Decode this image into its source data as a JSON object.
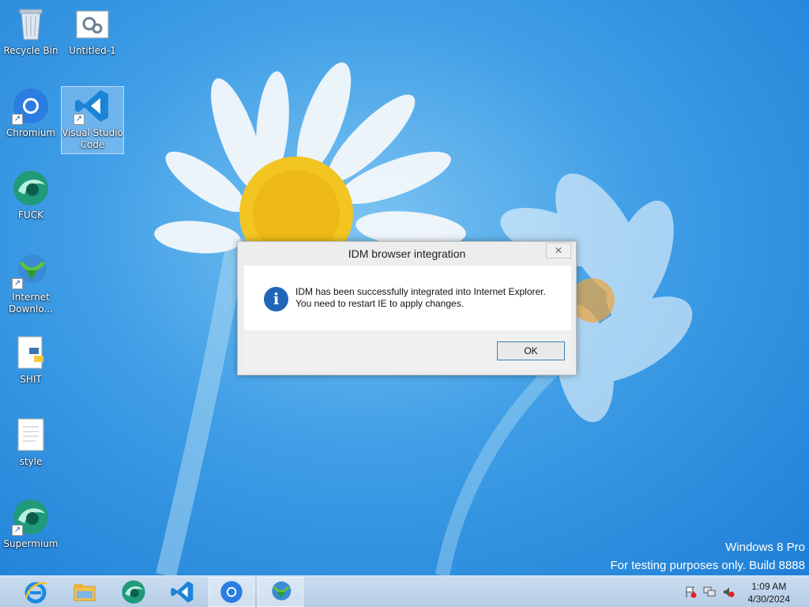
{
  "desktop_icons": [
    {
      "label": "Recycle Bin",
      "icon": "recycle-bin-icon"
    },
    {
      "label": "Untitled-1",
      "icon": "document-gear-icon"
    },
    {
      "label": "Chromium",
      "icon": "chromium-icon"
    },
    {
      "label": "Visual Studio Code",
      "icon": "vscode-icon"
    },
    {
      "label": "FUCK",
      "icon": "supermium-icon"
    },
    {
      "label": "Internet Downlo...",
      "icon": "idm-icon"
    },
    {
      "label": "SHIT",
      "icon": "python-file-icon"
    },
    {
      "label": "style",
      "icon": "text-file-icon"
    },
    {
      "label": "Supermium",
      "icon": "supermium-icon"
    }
  ],
  "watermark": {
    "edition": "Windows 8 Pro",
    "build": "For testing purposes only. Build 8888"
  },
  "dialog": {
    "title": "IDM browser integration",
    "close_label": "✕",
    "message_line1": "IDM has been successfully integrated into Internet Explorer.",
    "message_line2": "You need to restart IE to apply changes.",
    "ok_label": "OK",
    "icon": "info-icon"
  },
  "taskbar": {
    "apps": [
      "internet-explorer-icon",
      "file-explorer-icon",
      "supermium-icon",
      "vscode-icon",
      "chromium-icon",
      "idm-icon"
    ],
    "active_app": "chromium-icon"
  },
  "tray": {
    "icons": [
      "action-center-flag-icon",
      "network-icon",
      "volume-muted-icon"
    ],
    "time": "1:09 AM",
    "date": "4/30/2024"
  },
  "colors": {
    "accent": "#1f66b8",
    "taskbar": "#bcd2ea"
  }
}
